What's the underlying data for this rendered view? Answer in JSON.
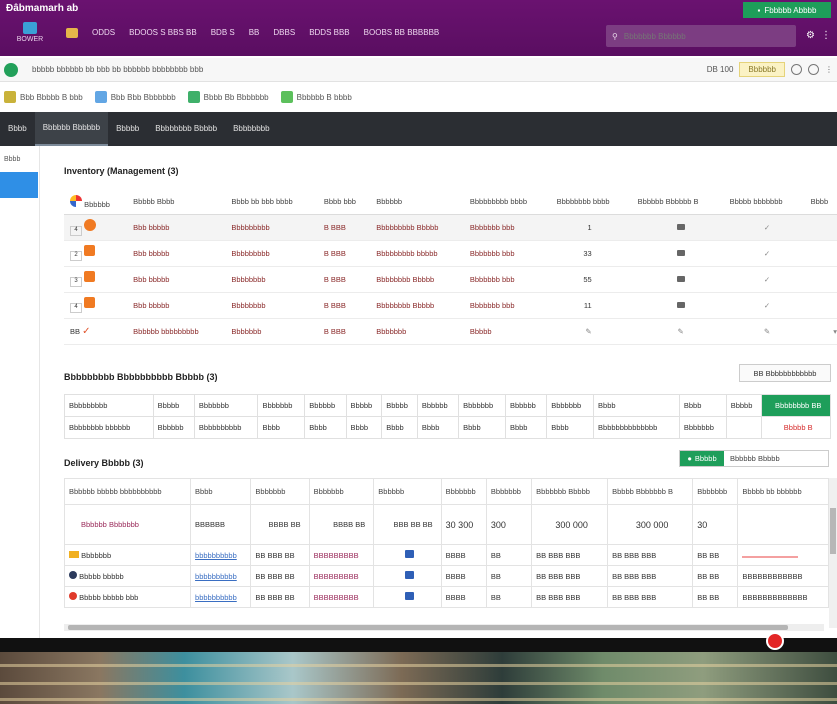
{
  "topbar": {
    "brand": "Đâbmamarh ab",
    "home_label": "BOWER",
    "menu": [
      "ODDS",
      "BDOOS S BBS BB",
      "BDB S",
      "BB",
      "DBBS",
      "BDDS BBB",
      "BOOBS BB BBBBBB"
    ],
    "cta_label": "Fbbbbb Abbbb",
    "search_placeholder": "Bbbbbbb Bbbbbb"
  },
  "addressbar": {
    "url": "bbbbb  bbbbbb  bb bbb bb bbbbbb bbbbbbbb bbb",
    "zoom": "DB 100",
    "pill": "Bbbbbb"
  },
  "bookmarks": [
    {
      "label": "Bbb Bbbbb B bbb",
      "color": "#c9b23a"
    },
    {
      "label": "Bbb Bbb Bbbbbbb",
      "color": "#62a6e4"
    },
    {
      "label": "Bbbb Bb Bbbbbbb",
      "color": "#3fb06a"
    },
    {
      "label": "Bbbbbb B bbbb",
      "color": "#5cc05c"
    }
  ],
  "darknav": {
    "tabs": [
      {
        "label": "Bbbb",
        "active": false
      },
      {
        "label": "Bbbbbb Bbbbbb",
        "active": true
      },
      {
        "label": "Bbbbb",
        "active": false
      },
      {
        "label": "Bbbbbbbb Bbbbb",
        "active": false
      },
      {
        "label": "Bbbbbbbb",
        "active": false
      }
    ]
  },
  "leftstrip": {
    "label": "Bbbb"
  },
  "inventory": {
    "title": "Inventory (Management (3)",
    "columns": [
      "Bbbbbb",
      "Bbbbb Bbbb",
      "Bbbb bb bbb bbbb",
      "Bbbb bbb",
      "Bbbbbb",
      "Bbbbbbbbb bbbb",
      "Bbbbbbbb bbbb",
      "Bbbbbb Bbbbbb B",
      "Bbbbb bbbbbbb",
      "Bbbb"
    ],
    "rows": [
      {
        "mark": "4",
        "name": "Bbb bbbbb",
        "desc": "Bbbbbbbbb",
        "code": "B BBB",
        "loc": "Bbbbbbbbb Bbbbb",
        "stock": "Bbbbbbb bbb",
        "qty": "1",
        "selected": true
      },
      {
        "mark": "2",
        "name": "Bbb bbbbb",
        "desc": "Bbbbbbbbb",
        "code": "B BBB",
        "loc": "Bbbbbbbbb bbbbb",
        "stock": "Bbbbbbb bbb",
        "qty": "33",
        "selected": false
      },
      {
        "mark": "3",
        "name": "Bbb bbbbb",
        "desc": "Bbbbbbbb",
        "code": "B BBB",
        "loc": "Bbbbbbbb Bbbbb",
        "stock": "Bbbbbbb bbb",
        "qty": "55",
        "selected": false
      },
      {
        "mark": "4",
        "name": "Bbb bbbbb",
        "desc": "Bbbbbbbb",
        "code": "B BBB",
        "loc": "Bbbbbbbb Bbbbb",
        "stock": "Bbbbbbb bbb",
        "qty": "11",
        "selected": false
      },
      {
        "mark": "BB",
        "name": "Bbbbbb bbbbbbbbb",
        "desc": "Bbbbbbb",
        "code": "B BBB",
        "loc": "Bbbbbbb",
        "stock": "Bbbbb",
        "qty": "",
        "selected": false
      }
    ]
  },
  "distribution": {
    "title": "Bbbbbbbbb Bbbbbbbbbb Bbbbb (3)",
    "add_label": "BB Bbbbbbbbbbbb",
    "columns": [
      "Bbbbbbbbb",
      "Bbbbb",
      "Bbbbbbb",
      "Bbbbbbb",
      "Bbbbbb",
      "Bbbbb",
      "Bbbbb",
      "Bbbbbb",
      "Bbbbbbb",
      "Bbbbbb",
      "Bbbbbbb",
      "Bbbb",
      "Bbbb",
      "Bbbbb",
      "Bbbbb"
    ],
    "row": [
      "Bbbbbbbb bbbbbb",
      "Bbbbbb",
      "Bbbbbbbbbb",
      "Bbbb",
      "Bbbb",
      "Bbbb",
      "Bbbb",
      "Bbbb",
      "Bbbb",
      "Bbbb",
      "Bbbb",
      "Bbbbbbbbbbbbbb",
      "Bbbbbbb",
      ""
    ],
    "green_btn": "Bbbbbbbb BB",
    "red_text": "Bbbbb B"
  },
  "delivery": {
    "title": "Delivery Bbbbb (3)",
    "toggle_on": "Bbbbb",
    "toggle_off": "Bbbbbb Bbbbb",
    "columns": [
      "Bbbbbb bbbbb bbbbbbbbbb",
      "Bbbb",
      "Bbbbbbb",
      "Bbbbbbb",
      "Bbbbbb",
      "Bbbbbbb",
      "Bbbbbbb",
      "Bbbbbbb Bbbbb",
      "Bbbbb Bbbbbbb B",
      "Bbbbbbb",
      "Bbbbb bb bbbbbb"
    ],
    "subrow": [
      "Bbbbbb Bbbbbbb",
      "BBBBBB",
      "BBBB BB",
      "BBBB BB",
      "BBB BB BB",
      "30 300",
      "300",
      "300 000",
      "300 000",
      "30",
      ""
    ],
    "rows": [
      {
        "label": "Bbbbbbb",
        "icon": "yellow",
        "link": "bbbbbbbbbb",
        "a": "BB BBB BB",
        "b": "BBBBBBBBB",
        "c": "BBBB",
        "d": "BB",
        "e": "BB BBB BBB",
        "f": "BB BBB BBB",
        "g": "BB BB",
        "h": ""
      },
      {
        "label": "Bbbbb bbbbb",
        "icon": "navy",
        "link": "bbbbbbbbbb",
        "a": "BB BBB BB",
        "b": "BBBBBBBBB",
        "c": "BBBB",
        "d": "BB",
        "e": "BB BBB BBB",
        "f": "BB BBB BBB",
        "g": "BB BB",
        "h": "BBBBBBBBBBBB"
      },
      {
        "label": "Bbbbb bbbbb bbb",
        "icon": "red",
        "link": "bbbbbbbbbb",
        "a": "BB BBB BB",
        "b": "BBBBBBBBB",
        "c": "BBBB",
        "d": "BB",
        "e": "BB BBB BBB",
        "f": "BB BBB BBB",
        "g": "BB BB",
        "h": "BBBBBBBBBBBBB"
      }
    ]
  },
  "colors": {
    "topbar": "#5f1066",
    "accent_green": "#1e9e5a",
    "accent_blue": "#2f8fe6",
    "darknav": "#2b2e33"
  }
}
